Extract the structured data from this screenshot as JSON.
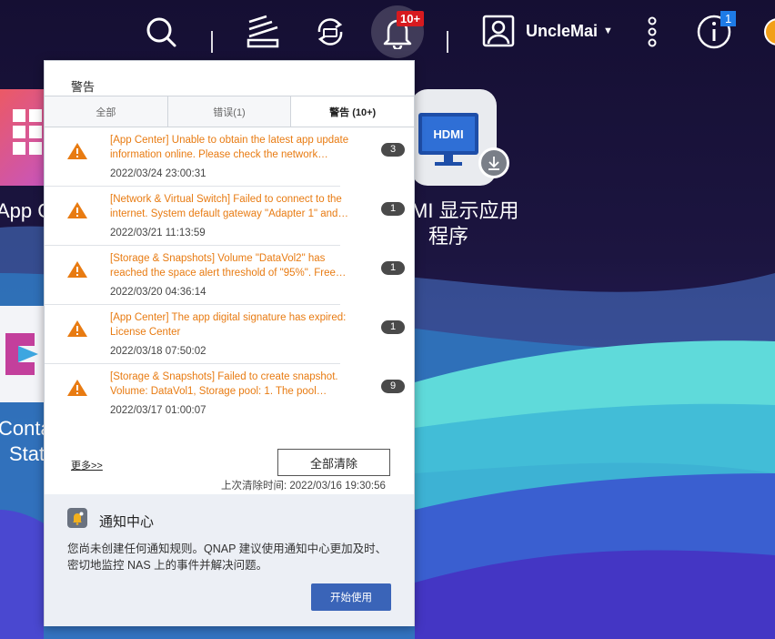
{
  "topbar": {
    "notification_badge": "10+",
    "info_badge": "1",
    "username": "UncleMai"
  },
  "desktop": {
    "apps": [
      {
        "label_line1": "App C",
        "label_line2": ""
      },
      {
        "label_line1": "MI 显示应用",
        "label_line2": "程序"
      },
      {
        "label_line1": "Conta",
        "label_line2": "Stat"
      }
    ]
  },
  "panel": {
    "title": "警告",
    "tabs": [
      {
        "label": "全部"
      },
      {
        "label": "错误(1)"
      },
      {
        "label": "警告 (10+)"
      }
    ],
    "items": [
      {
        "message": "[App Center] Unable to obtain the latest app update information online. Please check the network…",
        "time": "2022/03/24 23:00:31",
        "count": "3"
      },
      {
        "message": "[Network & Virtual Switch] Failed to connect to the internet. System default gateway \"Adapter 1\" and…",
        "time": "2022/03/21 11:13:59",
        "count": "1"
      },
      {
        "message": "[Storage & Snapshots] Volume \"DataVol2\" has reached the space alert threshold of \"95%\". Free…",
        "time": "2022/03/20 04:36:14",
        "count": "1"
      },
      {
        "message": "[App Center] The app digital signature has expired: License Center",
        "time": "2022/03/18 07:50:02",
        "count": "1"
      },
      {
        "message": "[Storage & Snapshots] Failed to create snapshot. Volume: DataVol1, Storage pool: 1. The pool…",
        "time": "2022/03/17 01:00:07",
        "count": "9"
      }
    ],
    "more_link": "更多>>",
    "clear_all_button": "全部清除",
    "last_cleared": "上次清除时间: 2022/03/16 19:30:56"
  },
  "notification_center": {
    "title": "通知中心",
    "description": "您尚未创建任何通知规则。QNAP 建议使用通知中心更加及时、密切地监控 NAS 上的事件并解决问题。",
    "start_button": "开始使用"
  },
  "colors": {
    "warning": "#e87b12",
    "primary_button": "#3a64b8",
    "badge_red": "#d71a1f",
    "badge_blue": "#1e7be6"
  }
}
